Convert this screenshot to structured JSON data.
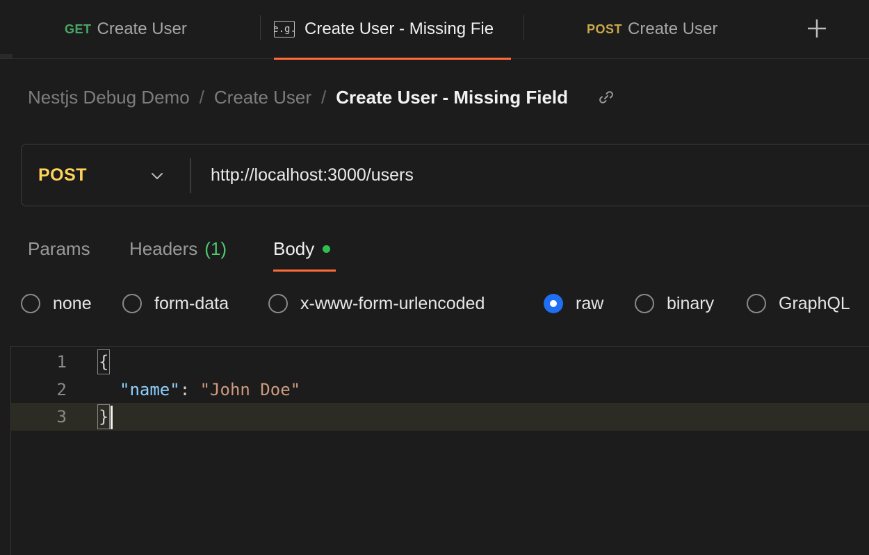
{
  "tabs": [
    {
      "method": "GET",
      "method_color": "#4aa867",
      "title": "Create User",
      "active": false
    },
    {
      "method": "",
      "icon": "e.g.",
      "title": "Create User - Missing Fie",
      "active": true
    },
    {
      "method": "POST",
      "method_color": "#c9a84a",
      "title": "Create User",
      "active": false
    }
  ],
  "breadcrumb": {
    "collection": "Nestjs Debug Demo",
    "folder": "Create User",
    "current": "Create User - Missing Field",
    "separator": "/"
  },
  "request": {
    "method": "POST",
    "url": "http://localhost:3000/users"
  },
  "request_tabs": {
    "params": "Params",
    "headers": "Headers",
    "headers_count": "(1)",
    "body": "Body"
  },
  "body_types": {
    "none": "none",
    "form_data": "form-data",
    "urlencoded": "x-www-form-urlencoded",
    "raw": "raw",
    "binary": "binary",
    "graphql": "GraphQL",
    "selected": "raw"
  },
  "editor": {
    "line_numbers": [
      "1",
      "2",
      "3"
    ],
    "open_brace": "{",
    "key": "\"name\"",
    "colon": ": ",
    "value": "\"John Doe\"",
    "close_brace": "}"
  },
  "colors": {
    "accent": "#ff6c37",
    "post": "#ffd45a",
    "radio_selected": "#1f6ff2",
    "headers_count": "#4fc770"
  }
}
